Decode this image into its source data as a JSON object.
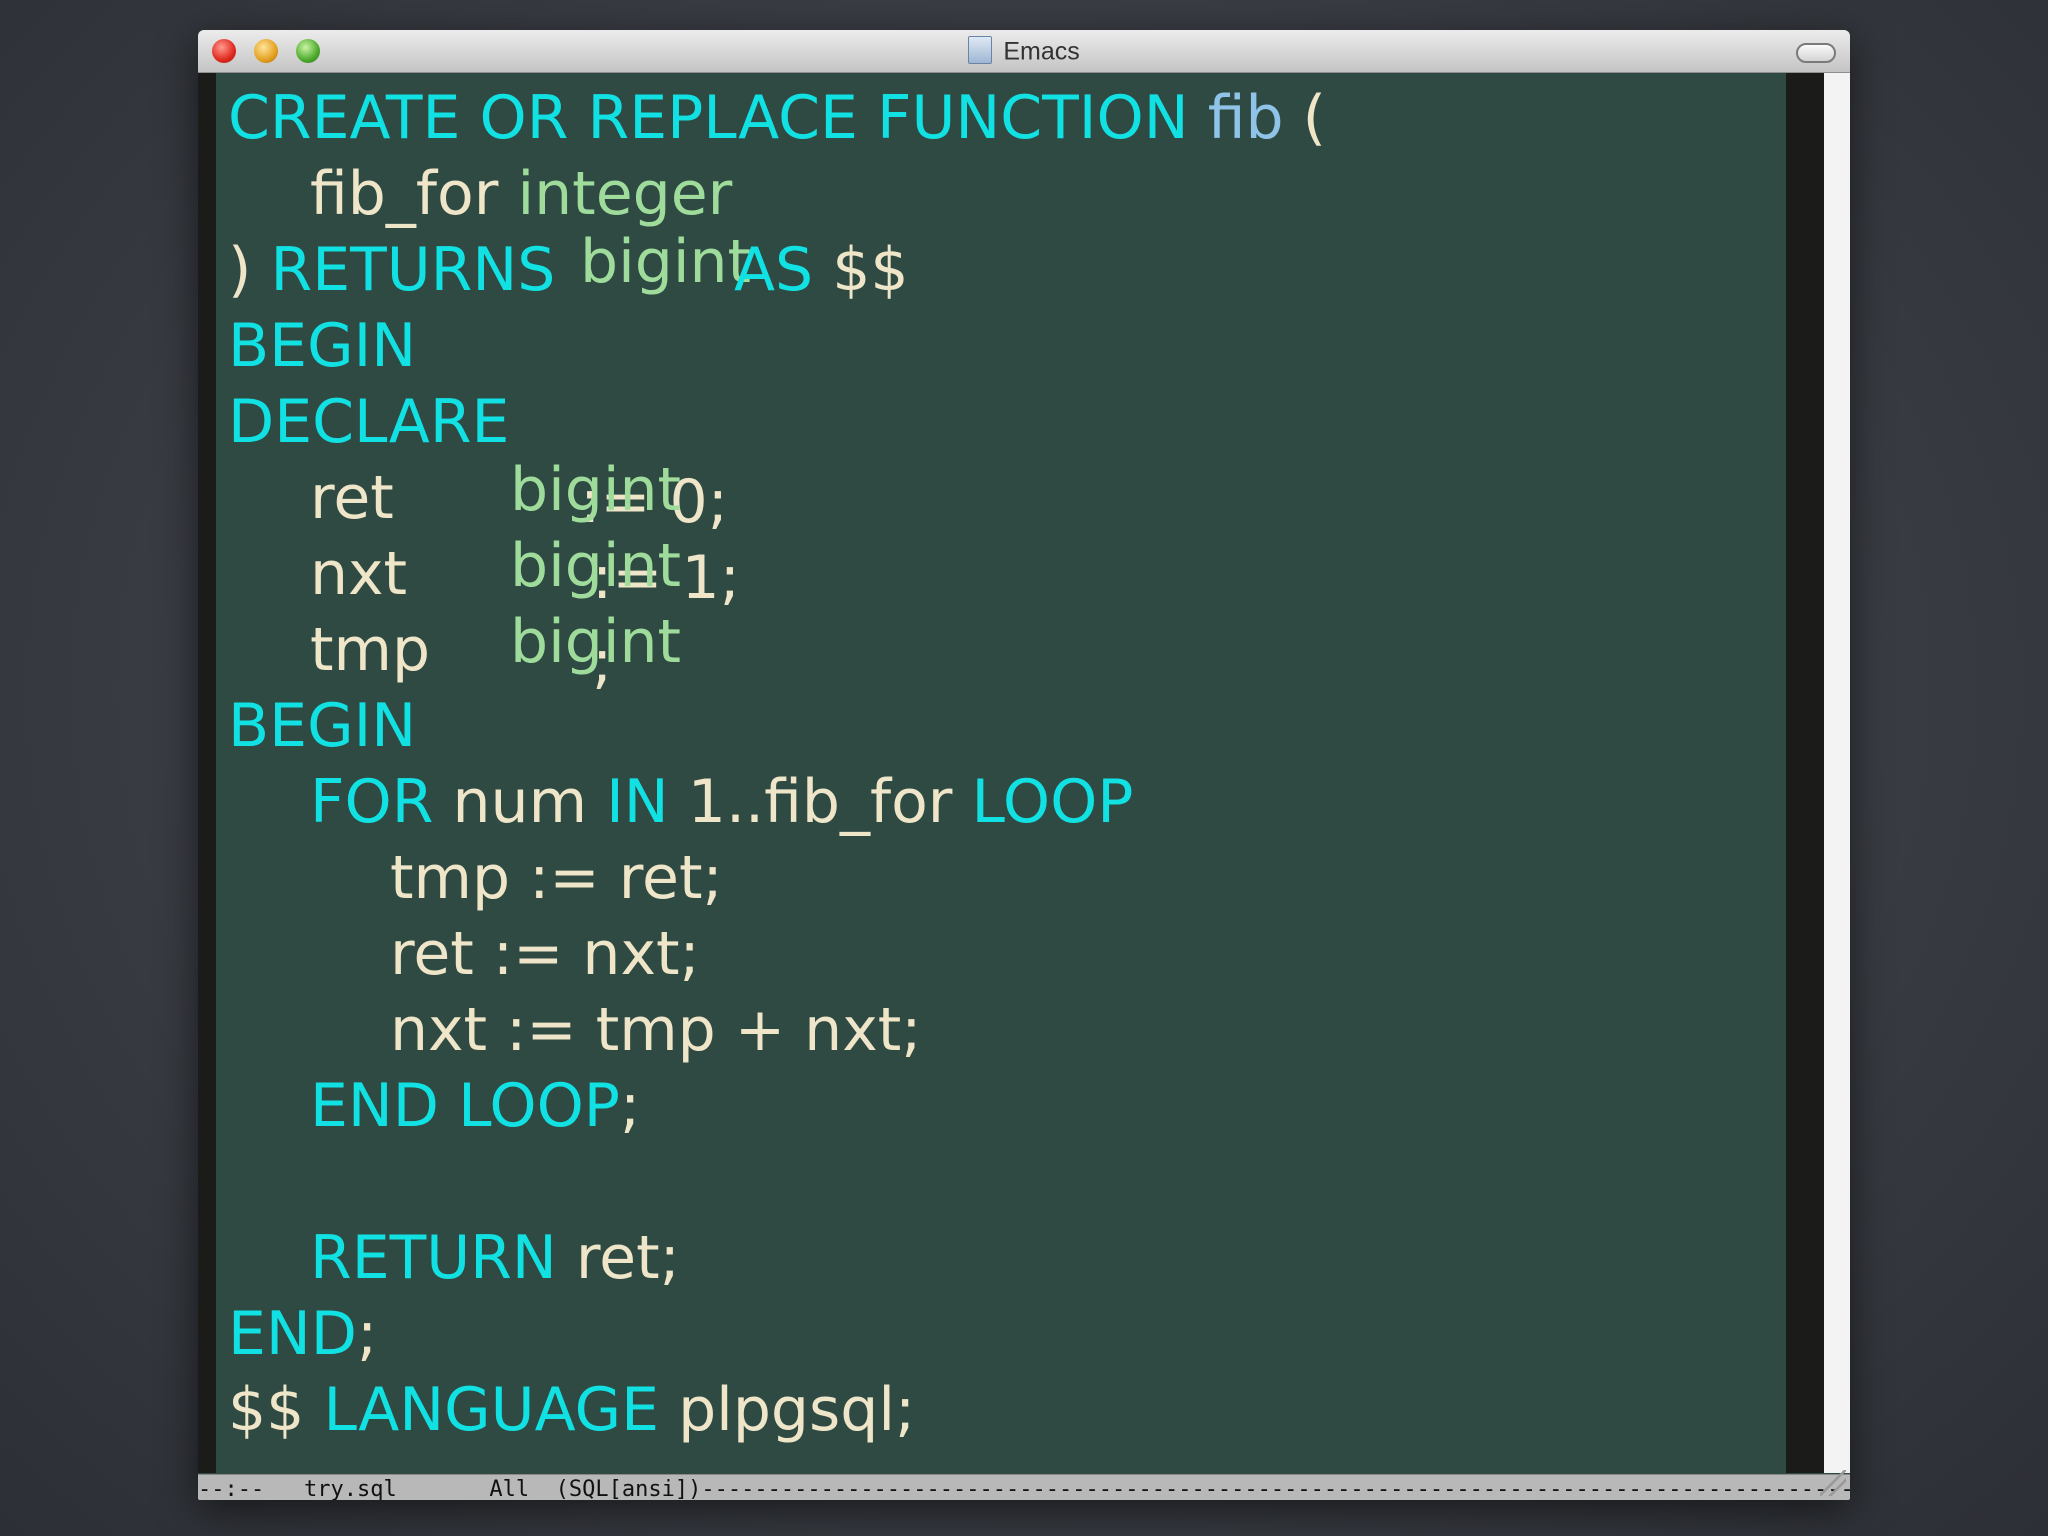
{
  "window": {
    "title": "Emacs"
  },
  "code": {
    "line1": {
      "kw": "CREATE OR REPLACE FUNCTION",
      "name": "fib",
      "paren": "("
    },
    "line2": {
      "param": "fib_for",
      "type": "integer"
    },
    "line3": {
      "paren": ")",
      "kw": "RETURNS",
      "type": "bigint",
      "as": "AS",
      "dollar": "$$"
    },
    "line4": {
      "kw": "BEGIN"
    },
    "line5": {
      "kw": "DECLARE"
    },
    "line6": {
      "var": "ret",
      "type": "bigint",
      "assign": ":= 0;"
    },
    "line7": {
      "var": "nxt",
      "type": "bigint",
      "assign": ":= 1;"
    },
    "line8": {
      "var": "tmp",
      "type": "bigint",
      "semi": ";"
    },
    "line9": {
      "kw": "BEGIN"
    },
    "line10": {
      "kw_for": "FOR",
      "mid1": "num",
      "kw_in": "IN",
      "mid2": "1..fib_for",
      "kw_loop": "LOOP"
    },
    "line11": {
      "text": "tmp := ret;"
    },
    "line12": {
      "text": "ret := nxt;"
    },
    "line13": {
      "text": "nxt := tmp + nxt;"
    },
    "line14": {
      "kw": "END LOOP",
      "semi": ";"
    },
    "line16": {
      "kw": "RETURN",
      "text": "ret;"
    },
    "line17": {
      "kw": "END",
      "semi": ";"
    },
    "line18": {
      "dollar": "$$",
      "kw": "LANGUAGE",
      "text": "plpgsql;"
    }
  },
  "modeline": {
    "status": "--:--",
    "filename": "try.sql",
    "position": "All",
    "mode": "(SQL[ansi])"
  }
}
